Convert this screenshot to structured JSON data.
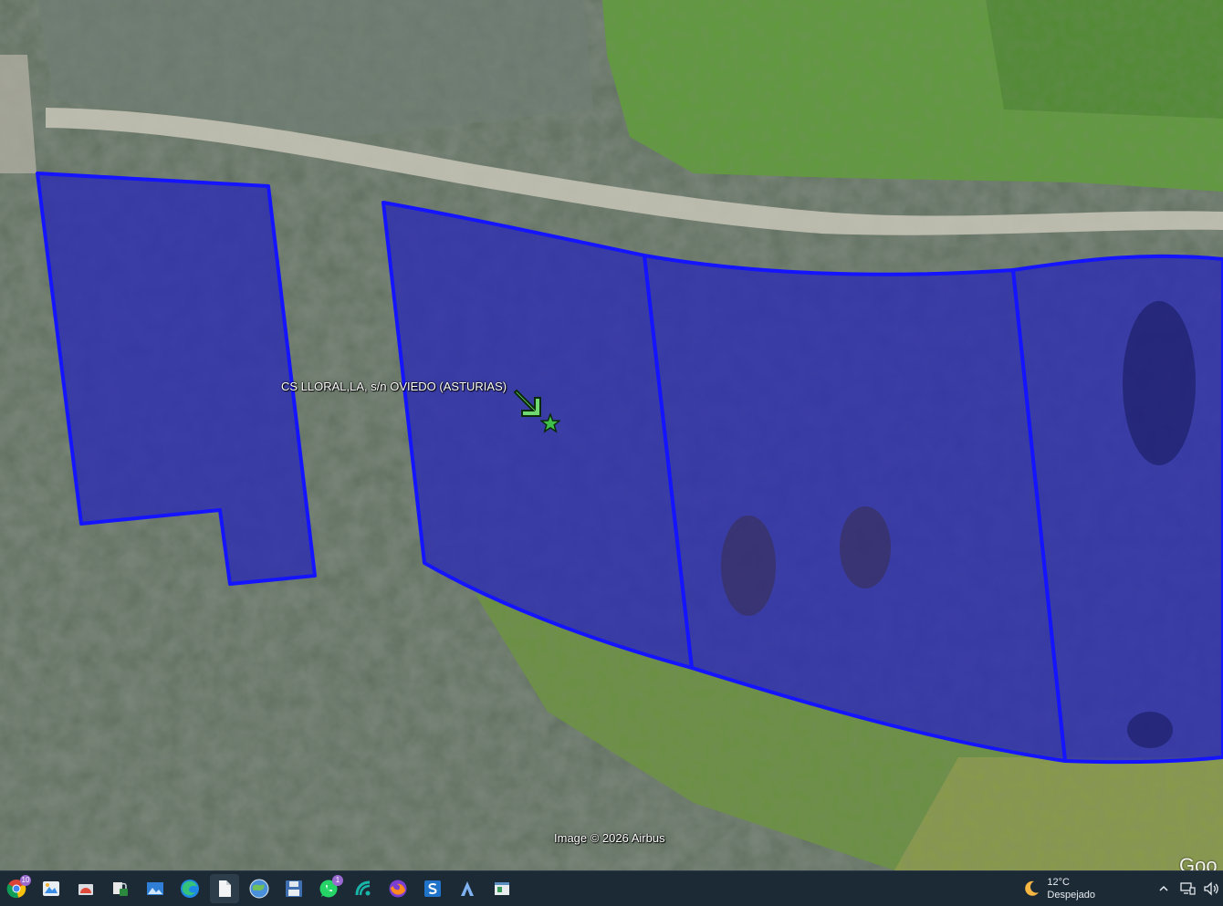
{
  "map": {
    "placemark_label": "CS LLORAL,LA, s/n OVIEDO (ASTURIAS)",
    "attribution": "Image © 2026 Airbus",
    "logo_text": "Goo",
    "parcel_fill_color": "#2a2ab4",
    "parcel_stroke_color": "#1414ff",
    "placemark_icons": [
      "arrow-pointer-icon",
      "green-star-icon"
    ]
  },
  "taskbar": {
    "apps": [
      {
        "name": "chrome-icon",
        "badge": "10"
      },
      {
        "name": "paint-icon",
        "badge": ""
      },
      {
        "name": "photos-icon",
        "badge": ""
      },
      {
        "name": "lock-files-icon",
        "badge": ""
      },
      {
        "name": "image-viewer-icon",
        "badge": ""
      },
      {
        "name": "edge-icon",
        "badge": ""
      },
      {
        "name": "document-icon",
        "badge": ""
      },
      {
        "name": "google-earth-icon",
        "badge": ""
      },
      {
        "name": "floppy-save-icon",
        "badge": ""
      },
      {
        "name": "whatsapp-icon",
        "badge": "1"
      },
      {
        "name": "connect-icon",
        "badge": ""
      },
      {
        "name": "firefox-icon",
        "badge": ""
      },
      {
        "name": "s-app-icon",
        "badge": ""
      },
      {
        "name": "triangle-app-icon",
        "badge": ""
      },
      {
        "name": "window-app-icon",
        "badge": ""
      }
    ],
    "weather": {
      "temperature": "12°C",
      "condition": "Despejado",
      "icon": "moon-icon"
    },
    "tray_icons": [
      "chevron-up-icon",
      "network-icon",
      "speaker-icon"
    ]
  }
}
